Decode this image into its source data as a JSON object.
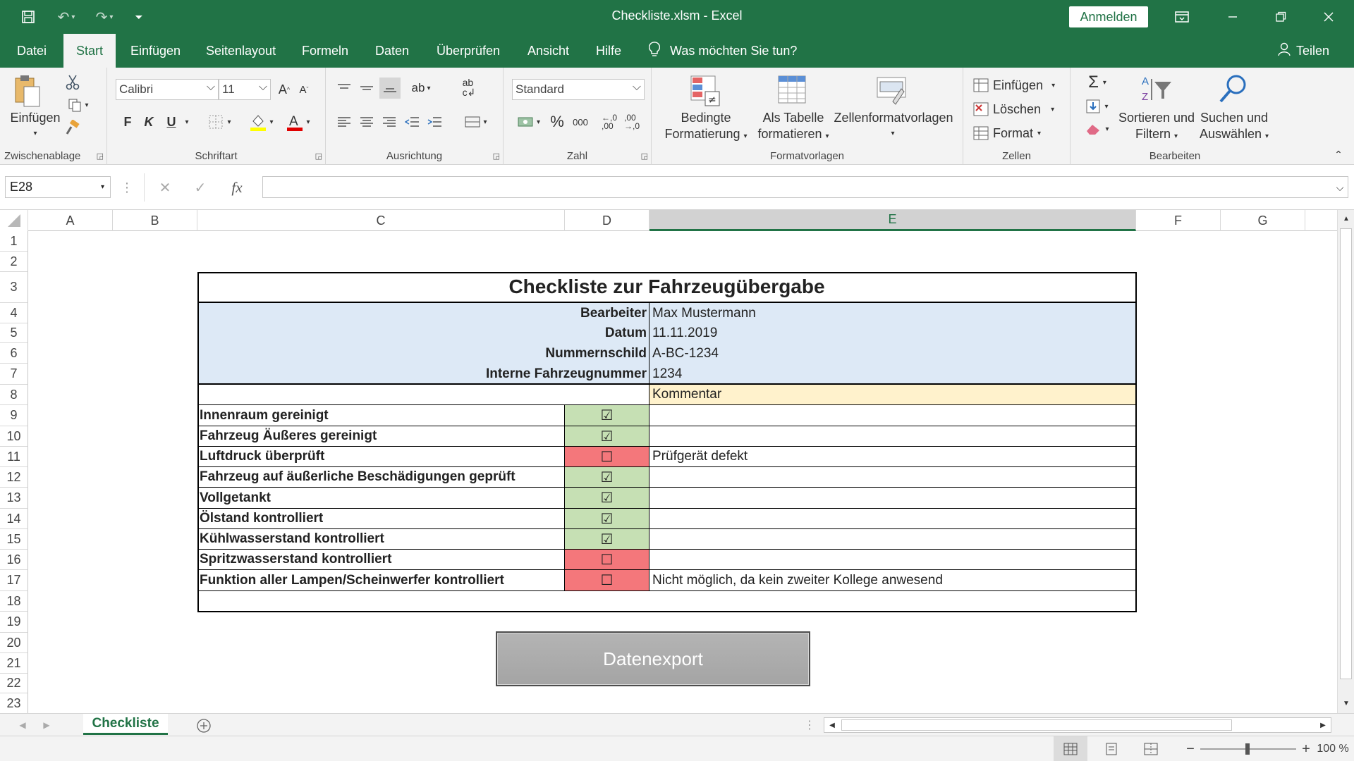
{
  "window": {
    "title": "Checkliste.xlsm  -  Excel",
    "signin_label": "Anmelden",
    "icons": {
      "save": "save-icon",
      "undo": "undo-icon",
      "redo": "redo-icon",
      "customize": "customize-quick-access-icon",
      "ribbon_display": "ribbon-display-options-icon",
      "minimize": "minimize-icon",
      "restore": "restore-icon",
      "close": "close-icon"
    }
  },
  "tabs": [
    "Datei",
    "Start",
    "Einfügen",
    "Seitenlayout",
    "Formeln",
    "Daten",
    "Überprüfen",
    "Ansicht",
    "Hilfe"
  ],
  "active_tab": "Start",
  "tell_me": "Was möchten Sie tun?",
  "share_label": "Teilen",
  "ribbon": {
    "clipboard": {
      "label": "Zwischenablage",
      "paste": "Einfügen"
    },
    "font": {
      "label": "Schriftart",
      "font_name": "Calibri",
      "font_size": "11",
      "bold": "F",
      "italic": "K",
      "underline": "U"
    },
    "alignment": {
      "label": "Ausrichtung"
    },
    "number": {
      "label": "Zahl",
      "format": "Standard",
      "percent": "%",
      "thousands": "000"
    },
    "styles": {
      "label": "Formatvorlagen",
      "conditional_l1": "Bedingte",
      "conditional_l2": "Formatierung",
      "table_l1": "Als Tabelle",
      "table_l2": "formatieren",
      "cellstyles": "Zellenformatvorlagen"
    },
    "cells": {
      "label": "Zellen",
      "insert": "Einfügen",
      "delete": "Löschen",
      "format": "Format"
    },
    "editing": {
      "label": "Bearbeiten",
      "sort_l1": "Sortieren und",
      "sort_l2": "Filtern",
      "find_l1": "Suchen und",
      "find_l2": "Auswählen"
    }
  },
  "formula_bar": {
    "name_box": "E28",
    "formula": "",
    "fx": "fx"
  },
  "columns": [
    "A",
    "B",
    "C",
    "D",
    "E",
    "F",
    "G"
  ],
  "selected_column": "E",
  "rows": [
    "1",
    "2",
    "3",
    "4",
    "5",
    "6",
    "7",
    "8",
    "9",
    "10",
    "11",
    "12",
    "13",
    "14",
    "15",
    "16",
    "17",
    "18",
    "19",
    "20",
    "21",
    "22",
    "23"
  ],
  "sheet": {
    "title": "Checkliste zur Fahrzeugübergabe",
    "info": [
      {
        "label": "Bearbeiter",
        "value": "Max Mustermann"
      },
      {
        "label": "Datum",
        "value": "11.11.2019"
      },
      {
        "label": "Nummernschild",
        "value": "A-BC-1234"
      },
      {
        "label": "Interne Fahrzeugnummer",
        "value": "1234"
      }
    ],
    "comment_header": "Kommentar",
    "tasks": [
      {
        "task": "Innenraum gereinigt",
        "status": "☑",
        "done": true,
        "comment": ""
      },
      {
        "task": "Fahrzeug Äußeres gereinigt",
        "status": "☑",
        "done": true,
        "comment": ""
      },
      {
        "task": "Luftdruck überprüft",
        "status": "☐",
        "done": false,
        "comment": "Prüfgerät defekt"
      },
      {
        "task": "Fahrzeug auf äußerliche Beschädigungen geprüft",
        "status": "☑",
        "done": true,
        "comment": ""
      },
      {
        "task": "Vollgetankt",
        "status": "☑",
        "done": true,
        "comment": ""
      },
      {
        "task": "Ölstand kontrolliert",
        "status": "☑",
        "done": true,
        "comment": ""
      },
      {
        "task": "Kühlwasserstand kontrolliert",
        "status": "☑",
        "done": true,
        "comment": ""
      },
      {
        "task": "Spritzwasserstand kontrolliert",
        "status": "☐",
        "done": false,
        "comment": ""
      },
      {
        "task": "Funktion aller Lampen/Scheinwerfer kontrolliert",
        "status": "☐",
        "done": false,
        "comment": "Nicht möglich, da kein zweiter Kollege anwesend"
      }
    ],
    "export_button": "Datenexport"
  },
  "colors": {
    "excel_green": "#217346",
    "info_fill": "#dde9f6",
    "comment_fill": "#fff2cc",
    "done_fill": "#c6e0b4",
    "open_fill": "#f4777b"
  },
  "sheet_tab": "Checkliste",
  "status": {
    "zoom": "100 %"
  }
}
